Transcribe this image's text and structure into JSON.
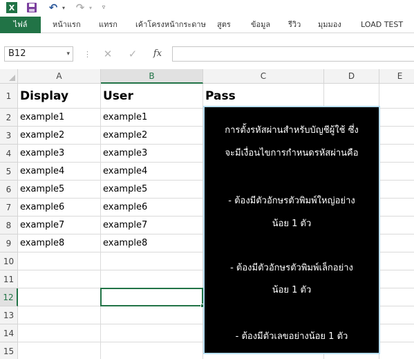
{
  "quick_access": {
    "app_icon": "excel-logo-icon",
    "app_letter": "X",
    "save_icon": "save-icon",
    "undo_icon": "undo-icon",
    "redo_icon": "redo-icon",
    "customize_icon": "customize-toolbar-icon"
  },
  "ribbon": {
    "tabs": [
      {
        "label": "ไฟล์",
        "active": true
      },
      {
        "label": "หน้าแรก"
      },
      {
        "label": "แทรก"
      },
      {
        "label": "เค้าโครงหน้ากระดาษ"
      },
      {
        "label": "สูตร"
      },
      {
        "label": "ข้อมูล"
      },
      {
        "label": "รีวิว"
      },
      {
        "label": "มุมมอง"
      },
      {
        "label": "LOAD TEST"
      }
    ]
  },
  "formula_bar": {
    "name_box": "B12",
    "cancel_glyph": "✕",
    "enter_glyph": "✓",
    "fx_label": "fx",
    "formula_value": ""
  },
  "sheet": {
    "columns": [
      "A",
      "B",
      "C",
      "D",
      "E"
    ],
    "rows": [
      "1",
      "2",
      "3",
      "4",
      "5",
      "6",
      "7",
      "8",
      "9",
      "10",
      "11",
      "12",
      "13",
      "14",
      "15"
    ],
    "selected_column": "B",
    "selected_row": "12",
    "headers": {
      "A": "Display",
      "B": "User",
      "C": "Pass"
    },
    "data": [
      {
        "A": "example1",
        "B": "example1"
      },
      {
        "A": "example2",
        "B": "example2"
      },
      {
        "A": "example3",
        "B": "example3"
      },
      {
        "A": "example4",
        "B": "example4"
      },
      {
        "A": "example5",
        "B": "example5"
      },
      {
        "A": "example6",
        "B": "example6"
      },
      {
        "A": "example7",
        "B": "example7"
      },
      {
        "A": "example8",
        "B": "example8"
      }
    ]
  },
  "textbox": {
    "lines": [
      "การตั้งรหัสผ่านสำหรับบัญชีผู้ใช้ ซึ่ง",
      "จะมีเงื่อนไขการกำหนดรหัสผ่านคือ",
      "- ต้องมีตัวอักษรตัวพิมพ์ใหญ่อย่าง",
      "น้อย 1 ตัว",
      "- ต้องมีตัวอักษรตัวพิมพ์เล็กอย่าง",
      "น้อย 1 ตัว",
      "- ต้องมีตัวเลขอย่างน้อย 1 ตัว"
    ]
  },
  "colors": {
    "excel_green": "#217346",
    "selection_header": "#e1e1e1",
    "shape_fill": "#000000",
    "shape_border": "#b7dff5"
  }
}
